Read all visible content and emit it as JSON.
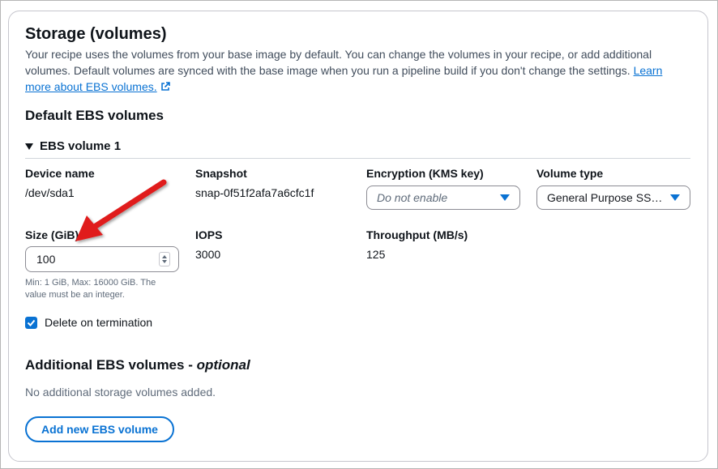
{
  "storage": {
    "title": "Storage (volumes)",
    "description": "Your recipe uses the volumes from your base image by default. You can change the volumes in your recipe, or add additional volumes. Default volumes are synced with the base image when you run a pipeline build if you don't change the settings.",
    "learn_more": "Learn more about EBS volumes."
  },
  "default_section": {
    "title": "Default EBS volumes",
    "volume_header": "EBS volume 1"
  },
  "fields": {
    "device_name_label": "Device name",
    "device_name_value": "/dev/sda1",
    "snapshot_label": "Snapshot",
    "snapshot_value": "snap-0f51f2afa7a6cfc1f",
    "encryption_label": "Encryption (KMS key)",
    "encryption_placeholder": "Do not enable",
    "volume_type_label": "Volume type",
    "volume_type_value": "General Purpose SS…",
    "size_label": "Size (GiB)",
    "size_value": "100",
    "size_hint": "Min: 1 GiB, Max: 16000 GiB. The value must be an integer.",
    "iops_label": "IOPS",
    "iops_value": "3000",
    "throughput_label": "Throughput (MB/s)",
    "throughput_value": "125",
    "delete_label": "Delete on termination",
    "delete_checked": true
  },
  "additional": {
    "title": "Additional EBS volumes - ",
    "title_optional": "optional",
    "empty": "No additional storage volumes added.",
    "add_button": "Add new EBS volume"
  },
  "colors": {
    "accent": "#0972d3",
    "annotation_arrow": "#e01b1b"
  },
  "icons": [
    "external-link-icon",
    "caret-down-icon",
    "dropdown-arrow-icon",
    "spinner-icon",
    "checkbox-check-icon",
    "annotation-arrow-icon"
  ]
}
